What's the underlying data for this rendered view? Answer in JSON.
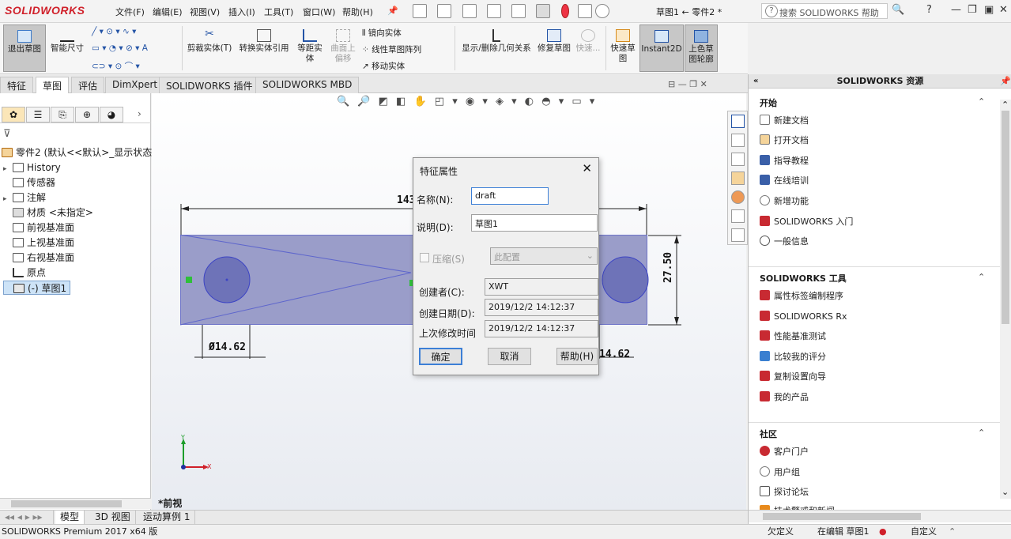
{
  "app": {
    "logo_text": "SOLIDWORKS",
    "document_title": "草图1 ← 零件2 *",
    "help_search_placeholder": "搜索 SOLIDWORKS 帮助",
    "brand_color": "#d0202a"
  },
  "menu": {
    "items": [
      "文件(F)",
      "编辑(E)",
      "视图(V)",
      "插入(I)",
      "工具(T)",
      "窗口(W)",
      "帮助(H)"
    ]
  },
  "ribbon": {
    "exit_sketch": "退出草图",
    "smart_dim": "智能尺寸",
    "trim": "剪裁实体(T)",
    "convert": "转换实体引用",
    "offset": "等距实体",
    "surface_offset": "曲面上偏移",
    "mirror": "镜向实体",
    "linear_pattern": "线性草图阵列",
    "move": "移动实体",
    "show_delete_relations": "显示/删除几何关系",
    "repair_sketch": "修复草图",
    "quick_snaps": "快速...",
    "rapid_sketch": "快速草图",
    "instant2d": "Instant2D",
    "shaded_contours": "上色草图轮廓"
  },
  "tabs": [
    "特征",
    "草图",
    "评估",
    "DimXpert",
    "SOLIDWORKS 插件",
    "SOLIDWORKS MBD"
  ],
  "tree": {
    "root": "零件2 (默认<<默认>_显示状态",
    "items": [
      {
        "label": "History",
        "arrow": "▸"
      },
      {
        "label": "传感器",
        "arrow": ""
      },
      {
        "label": "注解",
        "arrow": "▸"
      },
      {
        "label": "材质 <未指定>",
        "arrow": ""
      },
      {
        "label": "前视基准面",
        "arrow": ""
      },
      {
        "label": "上视基准面",
        "arrow": ""
      },
      {
        "label": "右视基准面",
        "arrow": ""
      },
      {
        "label": "原点",
        "arrow": ""
      },
      {
        "label": "(-) 草图1",
        "arrow": ""
      }
    ]
  },
  "viewport": {
    "view_label": "*前视",
    "dim_length": "143",
    "dim_height": "27.50",
    "dim_dia_left": "Ø14.62",
    "dim_dia_right": "14.62",
    "axis_y": "Y",
    "axis_x": "X"
  },
  "dialog": {
    "title": "特征属性",
    "name_label": "名称(N):",
    "name_value": "draft",
    "desc_label": "说明(D):",
    "desc_value": "草图1",
    "suppress_label": "压缩(S)",
    "config_value": "此配置",
    "creator_label": "创建者(C):",
    "creator_value": "XWT",
    "created_label": "创建日期(D):",
    "created_value": "2019/12/2 14:12:37",
    "modified_label": "上次修改时间",
    "modified_value": "2019/12/2 14:12:37",
    "ok": "确定",
    "cancel": "取消",
    "help": "帮助(H)"
  },
  "resources": {
    "title": "SOLIDWORKS 资源",
    "sections": [
      {
        "title": "开始",
        "items": [
          "新建文档",
          "打开文档",
          "指导教程",
          "在线培训",
          "新增功能",
          "SOLIDWORKS 入门",
          "一般信息"
        ]
      },
      {
        "title": "SOLIDWORKS 工具",
        "items": [
          "属性标签编制程序",
          "SOLIDWORKS Rx",
          "性能基准测试",
          "比较我的评分",
          "复制设置向导",
          "我的产品"
        ]
      },
      {
        "title": "社区",
        "items": [
          "客户门户",
          "用户组",
          "探讨论坛",
          "技术警戒和新闻"
        ]
      }
    ]
  },
  "bottom_tabs": [
    "模型",
    "3D 视图",
    "运动算例 1"
  ],
  "status": {
    "left": "SOLIDWORKS Premium 2017 x64 版",
    "under_defined": "欠定义",
    "editing": "在编辑 草图1",
    "custom": "自定义"
  }
}
